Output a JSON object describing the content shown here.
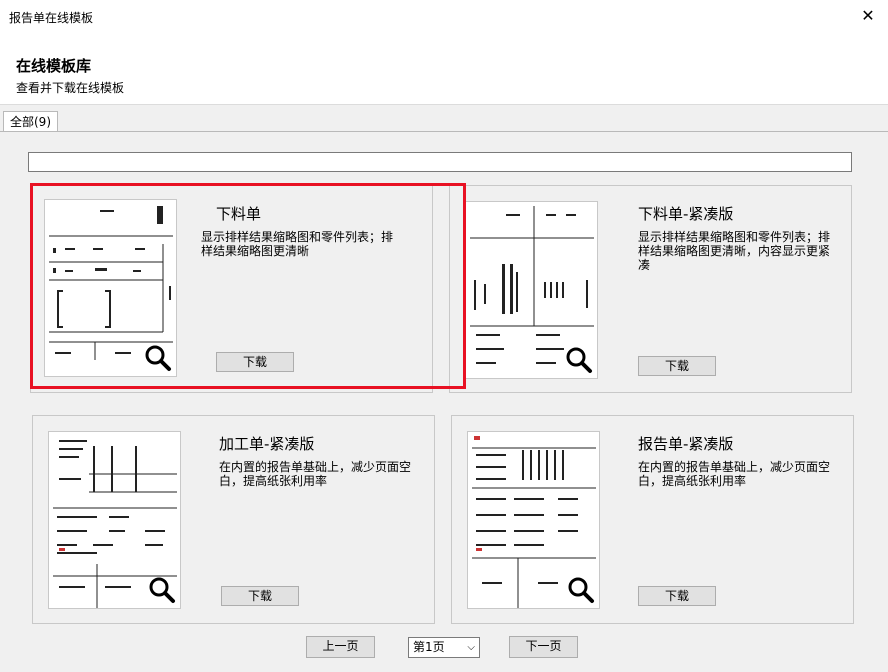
{
  "window": {
    "title": "报告单在线模板",
    "close_glyph": "✕"
  },
  "header": {
    "title": "在线模板库",
    "subtitle": "查看并下载在线模板"
  },
  "tabs": [
    {
      "label": "全部(9)"
    }
  ],
  "search": {
    "value": ""
  },
  "cards": [
    {
      "title": "下料单",
      "desc": "显示排样结果缩略图和零件列表；排样结果缩略图更清晰",
      "download": "下载"
    },
    {
      "title": "下料单-紧凑版",
      "desc": "显示排样结果缩略图和零件列表；排样结果缩略图更清晰，内容显示更紧凑",
      "download": "下载"
    },
    {
      "title": "加工单-紧凑版",
      "desc": "在内置的报告单基础上，减少页面空白，提高纸张利用率",
      "download": "下载"
    },
    {
      "title": "报告单-紧凑版",
      "desc": "在内置的报告单基础上，减少页面空白，提高纸张利用率",
      "download": "下载"
    }
  ],
  "pagination": {
    "prev": "上一页",
    "page": "第1页",
    "next": "下一页"
  },
  "colors": {
    "highlight": "#e81123"
  }
}
